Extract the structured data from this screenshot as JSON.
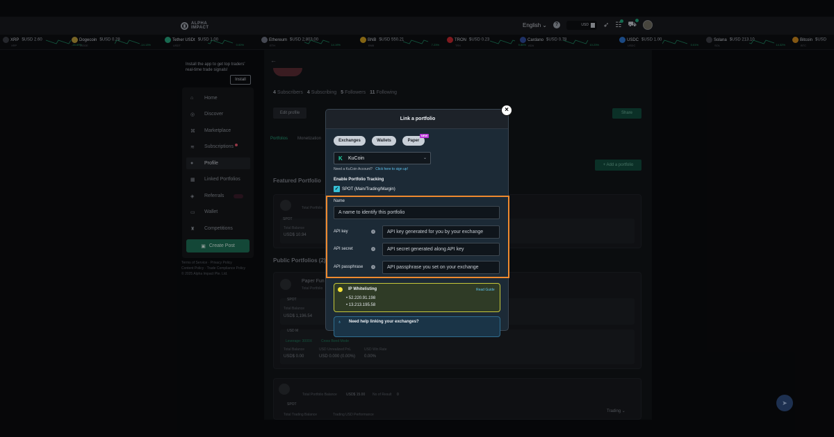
{
  "header": {
    "logo_line1": "ALPHA",
    "logo_line2": "IMPACT",
    "language": "English",
    "currency": "USD"
  },
  "ticker": [
    {
      "name": "XRP",
      "price": "$USD 2.60",
      "sub": "XRP",
      "change": "-16.69%",
      "color": "#3a3d44"
    },
    {
      "name": "Dogecoin",
      "price": "$USD 0.28",
      "sub": "DOGE",
      "change": "-14.13%",
      "color": "#b99a3a"
    },
    {
      "name": "Tether USDt",
      "price": "$USD 1.00",
      "sub": "USDT",
      "change": "0.00%",
      "color": "#26a17b"
    },
    {
      "name": "Ethereum",
      "price": "$USD 2,803.00",
      "sub": "ETH",
      "change": "14.19%",
      "color": "#6a6f7e"
    },
    {
      "name": "BNB",
      "price": "$USD 550.21",
      "sub": "BNB",
      "change": "7.23%",
      "color": "#c99a1e"
    },
    {
      "name": "TRON",
      "price": "$USD 0.23",
      "sub": "TRX",
      "change": "9.86%",
      "color": "#c4272e"
    },
    {
      "name": "Cardano",
      "price": "$USD 0.78",
      "sub": "ADA",
      "change": "10.23%",
      "color": "#2f4a9a"
    },
    {
      "name": "USDC",
      "price": "$USD 1.00",
      "sub": "USDC",
      "change": "0.01%",
      "color": "#2a70c9"
    },
    {
      "name": "Solana",
      "price": "$USD 213.10",
      "sub": "SOL",
      "change": "14.32%",
      "color": "#3c3e46"
    },
    {
      "name": "Bitcoin",
      "price": "$USD",
      "sub": "BTC",
      "change": "",
      "color": "#c9861e"
    }
  ],
  "sidebar": {
    "promo_text": "Install the app to get top traders' real-time trade signals!",
    "install_label": "Install",
    "items": [
      {
        "label": "Home",
        "icon": "home-icon",
        "glyph": "⌂"
      },
      {
        "label": "Discover",
        "icon": "compass-icon",
        "glyph": "◎"
      },
      {
        "label": "Marketplace",
        "icon": "marketplace-icon",
        "glyph": "⌘"
      },
      {
        "label": "Subscriptions",
        "icon": "signal-icon",
        "glyph": "≋"
      },
      {
        "label": "Profile",
        "icon": "user-icon",
        "glyph": "●"
      },
      {
        "label": "Linked Portfolios",
        "icon": "chart-icon",
        "glyph": "▦"
      },
      {
        "label": "Referrals",
        "icon": "gift-icon",
        "glyph": "◈"
      },
      {
        "label": "Wallet",
        "icon": "wallet-icon",
        "glyph": "▭"
      },
      {
        "label": "Competitions",
        "icon": "trophy-icon",
        "glyph": "♜"
      }
    ],
    "create_post_label": "Create Post",
    "footer_line1": "Terms of Service · Privacy Policy",
    "footer_line2": "Content Policy · Trade Compliance Policy",
    "footer_line3": "© 2025 Alpha Impact Pte. Ltd."
  },
  "profile": {
    "subscribers_count": "4",
    "subscribers_label": "Subscribers",
    "subscribing_count": "4",
    "subscribing_label": "Subscribing",
    "followers_count": "5",
    "followers_label": "Followers",
    "following_count": "11",
    "following_label": "Following",
    "edit_profile_label": "Edit profile",
    "share_label": "Share",
    "tab_portfolios": "Portfolios",
    "tab_monetization": "Monetization",
    "add_portfolio_label": "+ Add a portfolio",
    "featured_heading": "Featured Portfolio",
    "public_heading": "Public Portfolios (2)",
    "featured_total_label": "Total Portfolio",
    "spot_label": "SPOT",
    "total_balance_label": "Total Balance",
    "featured_balance": "USD$ 10.94",
    "paper_name": "Paper Fun",
    "paper_sub": "Total Portfolio",
    "paper_balance": "USD$ 1,196.54",
    "usd_label": "USD M",
    "leverage_label": "Leverage: 3000X",
    "mode_label": "Cross Bond Mode",
    "unrealized_label": "USD Unrealized PnL",
    "winrate_label": "USD Win Rate",
    "balance_small": "USD$ 0.00",
    "unrealized_val": "USD 0.000 (0.00%)",
    "winrate_val": "0.00%",
    "bottom_total_label": "Total Portfolio Balance",
    "bottom_total_val": "USD$ 15.00",
    "no_results": "No of Result",
    "no_results_val": "0",
    "trading_balance_label": "Total Trading Balance",
    "trading_perf_label": "Trading USD Performance",
    "trading_dropdown": "Trading"
  },
  "modal": {
    "title": "Link a portfolio",
    "tab_exchanges": "Exchanges",
    "tab_wallets": "Wallets",
    "tab_paper": "Paper",
    "new_badge": "NEW",
    "selected_exchange": "KuCoin",
    "need_account_text": "Need a KuCoin Account?",
    "signup_link": "Click here to sign up!",
    "enable_tracking_label": "Enable Portfolio Tracking",
    "spot_option": "SPOT (Main/Trading/Margin)",
    "name_label": "Name",
    "name_placeholder": "A name to identify this portfolio",
    "api_key_label": "API key",
    "api_key_placeholder": "API key generated for you by your exchange",
    "api_secret_label": "API secret",
    "api_secret_placeholder": "API secret generated along API key",
    "api_passphrase_label": "API passphrase",
    "api_passphrase_placeholder": "API passphrase you set on your exchange",
    "ip_title": "IP Whitelisting",
    "ip_guide_link": "Read Guide",
    "ip_1": "52.220.91.198",
    "ip_2": "13.213.195.58",
    "help_title": "Need help linking your exchanges?"
  },
  "colors": {
    "accent_green": "#25a078",
    "highlight_orange": "#f08a2e",
    "link_blue": "#5fc4f0",
    "new_badge": "#b935d9"
  }
}
